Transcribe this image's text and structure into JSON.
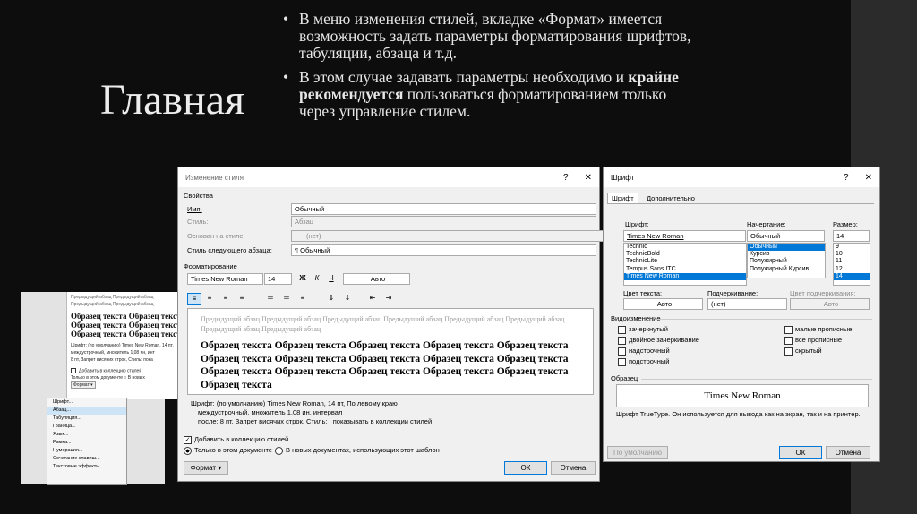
{
  "slide": {
    "title": "Главная",
    "bullet_char": "•",
    "bullet1": "В меню изменения стилей, вкладке «Формат» имеется возможность задать параметры форматирования шрифтов, табуляции, абзаца и т.д.",
    "bullet2_before": "В этом случае задавать параметры необходимо и ",
    "bullet2_bold": "крайне рекомендуется",
    "bullet2_after": " пользоваться форматированием только через управление стилем."
  },
  "bg_screenshot": {
    "grey_line": "Предыдущий абзац Предыдущий абзац",
    "sample_lines": [
      "Образец текста Образец текста",
      "Образец текста Образец текста",
      "Образец текста Образец текста"
    ],
    "desc1": "Шрифт: (по умолчанию) Times New Roman, 14 пт,",
    "desc2": "междустрочный, множитель 1,08 ин, инт",
    "desc3": "8 пт, Запрет висячих строк, Стиль: пока",
    "add_label": "Добавить в коллекцию стилей",
    "only_doc": "Только в этом документе",
    "new_docs": "В новых",
    "format_btn": "Формат ▾",
    "menu": [
      "Шрифт...",
      "Абзац...",
      "Табуляция...",
      "Граница...",
      "Язык...",
      "Рамка...",
      "Нумерация...",
      "Сочетание клавиш...",
      "Текстовые эффекты..."
    ]
  },
  "style_dialog": {
    "title": "Изменение стиля",
    "help": "?",
    "close": "✕",
    "section_props": "Свойства",
    "name_label": "Имя:",
    "name_value": "Обычный",
    "style_label": "Стиль:",
    "style_value": "Абзац",
    "based_label": "Основан на стиле:",
    "based_value": "(нет)",
    "next_label": "Стиль следующего абзаца:",
    "next_value": "¶ Обычный",
    "section_format": "Форматирование",
    "font": "Times New Roman",
    "size": "14",
    "bold": "Ж",
    "italic": "К",
    "underline": "Ч",
    "color": "Авто",
    "preview_grey": "Предыдущий абзац Предыдущий абзац Предыдущий абзац Предыдущий абзац Предыдущий абзац Предыдущий абзац Предыдущий абзац Предыдущий абзац",
    "preview_lines": [
      "Образец текста Образец текста Образец текста Образец текста Образец текста",
      "Образец текста Образец текста Образец текста Образец текста Образец текста",
      "Образец текста Образец текста Образец текста Образец текста Образец текста",
      "Образец текста"
    ],
    "desc_line1": "Шрифт: (по умолчанию) Times New Roman, 14 пт, По левому краю",
    "desc_line2": "междустрочный, множитель 1,08 ин, интервал",
    "desc_line3": "после: 8 пт, Запрет висячих строк, Стиль: : показывать в коллекции стилей",
    "add_to_gallery": "Добавить в коллекцию стилей",
    "only_this_doc": "Только в этом документе",
    "new_docs": "В новых документах, использующих этот шаблон",
    "format_button": "Формат ▾",
    "ok": "ОК",
    "cancel": "Отмена"
  },
  "font_dialog": {
    "title": "Шрифт",
    "help": "?",
    "close": "✕",
    "tab_font": "Шрифт",
    "tab_advanced": "Дополнительно",
    "font_label": "Шрифт:",
    "font_value": "Times New Roman",
    "font_list": [
      "Technic",
      "TechnicBold",
      "TechnicLite",
      "Tempus Sans ITC",
      "Times New Roman"
    ],
    "style_label": "Начертание:",
    "style_value": "Обычный",
    "style_list": [
      "Обычный",
      "Курсив",
      "Полужирный",
      "Полужирный Курсив"
    ],
    "size_label": "Размер:",
    "size_value": "14",
    "size_list": [
      "9",
      "10",
      "11",
      "12",
      "14"
    ],
    "color_label": "Цвет текста:",
    "color_value": "Авто",
    "underline_label": "Подчеркивание:",
    "underline_value": "(нет)",
    "underline_color_label": "Цвет подчеркивания:",
    "underline_color_value": "Авто",
    "effects_label": "Видоизменение",
    "effects_left": [
      "зачеркнутый",
      "двойное зачеркивание",
      "надстрочный",
      "подстрочный"
    ],
    "effects_right": [
      "малые прописные",
      "все прописные",
      "скрытый"
    ],
    "sample_label": "Образец",
    "sample_text": "Times New Roman",
    "info": "Шрифт TrueType. Он используется для вывода как на экран, так и на принтер.",
    "default_button": "По умолчанию",
    "ok": "ОК",
    "cancel": "Отмена"
  },
  "colors": {
    "accent": "#0078d7",
    "slide_bg": "#0d0d0d",
    "slide_text": "#e6e6e6"
  }
}
